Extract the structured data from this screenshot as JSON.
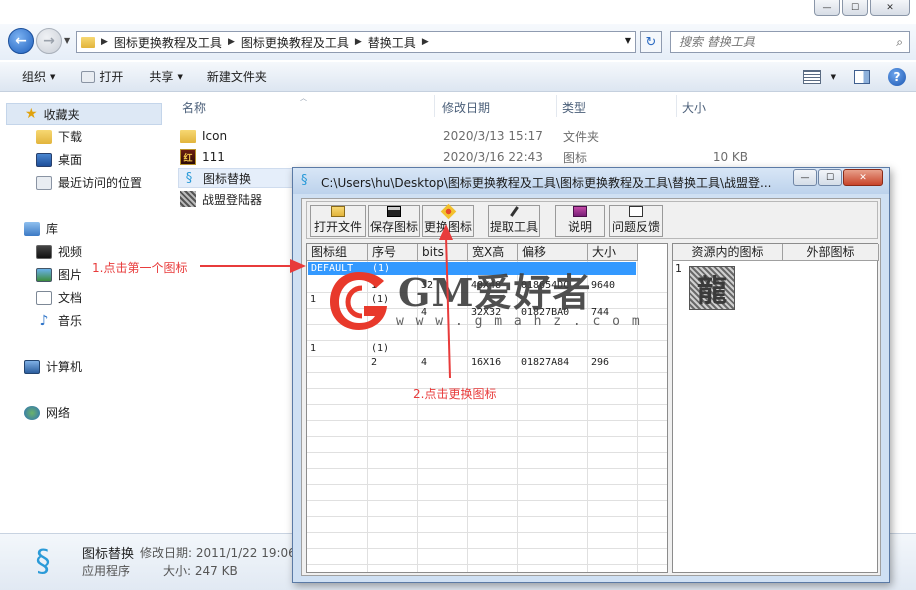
{
  "window": {
    "min_glyph": "—",
    "max_glyph": "☐",
    "close_glyph": "✕"
  },
  "nav": {
    "back_glyph": "←",
    "forward_glyph": "→",
    "history_glyph": "▼",
    "address": {
      "breadcrumbs": [
        "图标更换教程及工具",
        "图标更换教程及工具",
        "替换工具"
      ],
      "dropdown_glyph": "▼"
    },
    "refresh_glyph": "↻",
    "search": {
      "placeholder": "搜索 替换工具",
      "icon": "magnifier-icon",
      "icon_glyph": "⌕"
    }
  },
  "toolbar": {
    "organize": "组织",
    "open": "打开",
    "share": "共享",
    "new_folder": "新建文件夹",
    "caret_glyph": "▼",
    "help_glyph": "?"
  },
  "sidebar": {
    "favorites": "收藏夹",
    "favorites_items": [
      "下载",
      "桌面",
      "最近访问的位置"
    ],
    "library": "库",
    "library_items": [
      "视频",
      "图片",
      "文档",
      "音乐"
    ],
    "computer": "计算机",
    "network": "网络",
    "star_glyph": "★",
    "music_glyph": "♪"
  },
  "filelist": {
    "headers": {
      "name": "名称",
      "modified": "修改日期",
      "type": "类型",
      "size": "大小"
    },
    "sort_glyph": "︿",
    "rows": [
      {
        "name": "Icon",
        "modified": "2020/3/13 15:17",
        "type": "文件夹",
        "size": "",
        "icon": "folder-icon"
      },
      {
        "name": "111",
        "modified": "2020/3/16 22:43",
        "type": "图标",
        "size": "10 KB",
        "icon": "app-111-icon",
        "glyph": "红"
      },
      {
        "name": "图标替换",
        "modified": "",
        "type": "",
        "size": "",
        "icon": "swirl-app-icon",
        "glyph": "§"
      },
      {
        "name": "战盟登陆器",
        "modified": "",
        "type": "",
        "size": "",
        "icon": "zhanmeng-icon"
      }
    ]
  },
  "details": {
    "name": "图标替换",
    "modified_label": "修改日期: 2011/1/22 19:06",
    "type": "应用程序",
    "size_label": "大小: 247 KB",
    "icon_glyph": "§"
  },
  "dialog": {
    "title": "C:\\Users\\hu\\Desktop\\图标更换教程及工具\\图标更换教程及工具\\替换工具\\战盟登...",
    "icon_glyph": "§",
    "min_glyph": "—",
    "max_glyph": "☐",
    "close_glyph": "✕",
    "buttons": {
      "open_file": "打开文件",
      "save_icon": "保存图标",
      "replace_icon": "更换图标",
      "extract_tool": "提取工具",
      "readme": "说明",
      "feedback": "问题反馈"
    },
    "table": {
      "headers": [
        "图标组",
        "序号",
        "bits",
        "宽X高",
        "偏移",
        "大小"
      ],
      "rows": [
        {
          "group": "DEFAULT",
          "index": "(1)",
          "bits": "",
          "wh": "",
          "offset": "",
          "size": ""
        },
        {
          "group": "",
          "index": "1",
          "bits": "32",
          "wh": "48X48",
          "offset": "018654DC",
          "size": "9640"
        },
        {
          "group": "1",
          "index": "(1)",
          "bits": "",
          "wh": "",
          "offset": "",
          "size": ""
        },
        {
          "group": "",
          "index": "",
          "bits": "4",
          "wh": "32X32",
          "offset": "01827BA0",
          "size": "744"
        },
        {
          "group": "1",
          "index": "(1)",
          "bits": "",
          "wh": "",
          "offset": "",
          "size": ""
        },
        {
          "group": "",
          "index": "2",
          "bits": "4",
          "wh": "16X16",
          "offset": "01827A84",
          "size": "296"
        }
      ]
    },
    "res_headers": {
      "internal": "资源内的图标",
      "external": "外部图标"
    },
    "res_index": "1",
    "res_icon_glyph": "龍"
  },
  "watermark": {
    "text": "GM爱好者",
    "url": "w w w . g m a h z . c o m"
  },
  "annotations": {
    "step1": "1.点击第一个图标",
    "step2": "2.点击更换图标",
    "color": "#e83b3b"
  }
}
